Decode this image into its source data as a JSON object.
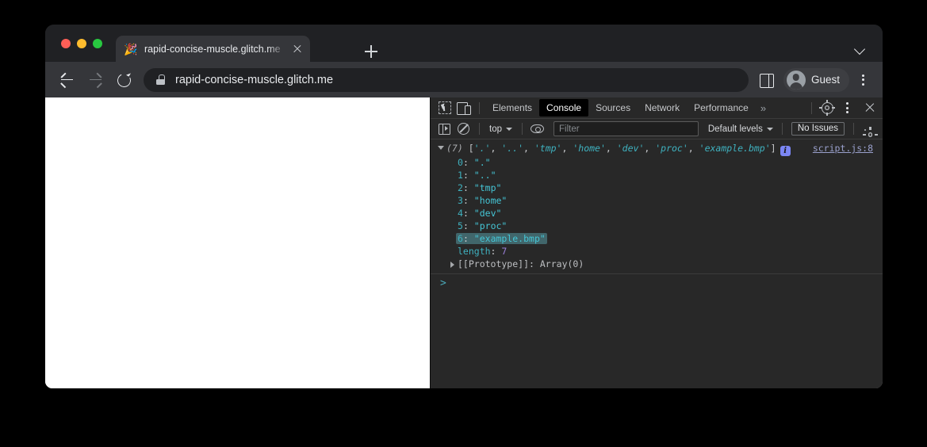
{
  "window": {
    "traffic_lights": [
      "close",
      "minimize",
      "maximize"
    ]
  },
  "tab": {
    "favicon": "party-popper-icon",
    "favicon_glyph": "🎉",
    "title": "rapid-concise-muscle.glitch.me",
    "close_label": "×"
  },
  "tabstrip": {
    "new_tab_label": "+",
    "tab_search_label": "⌄"
  },
  "toolbar": {
    "back_label": "Back",
    "forward_label": "Forward",
    "reload_label": "Reload",
    "url": "rapid-concise-muscle.glitch.me",
    "lock_label": "View site information",
    "side_panel_label": "Side panel",
    "profile_name": "Guest",
    "menu_label": "Customize and control Google Chrome"
  },
  "devtools": {
    "tabs": [
      {
        "label": "Elements",
        "active": false
      },
      {
        "label": "Console",
        "active": true
      },
      {
        "label": "Sources",
        "active": false
      },
      {
        "label": "Network",
        "active": false
      },
      {
        "label": "Performance",
        "active": false
      }
    ],
    "more_tabs_label": "»",
    "settings_label": "Settings",
    "menu_label": "More options",
    "close_label": "Close DevTools",
    "filterbar": {
      "sidebar_toggle_label": "Show console sidebar",
      "clear_label": "Clear console",
      "context": "top",
      "eye_label": "Create live expression",
      "filter_placeholder": "Filter",
      "filter_value": "",
      "levels": "Default levels",
      "issues": "No Issues",
      "settings_label": "Console settings"
    }
  },
  "console": {
    "entry": {
      "count_label": "(7)",
      "bracket_open": "[",
      "bracket_close": "]",
      "preview_items": [
        "'.'",
        "'..'",
        "'tmp'",
        "'home'",
        "'dev'",
        "'proc'",
        "'example.bmp'"
      ],
      "separator": ", ",
      "info_badge": "i",
      "source": "script.js:8",
      "properties": [
        {
          "index": "0",
          "value": "\".\"",
          "selected": false
        },
        {
          "index": "1",
          "value": "\"..\"",
          "selected": false
        },
        {
          "index": "2",
          "value": "\"tmp\"",
          "selected": false
        },
        {
          "index": "3",
          "value": "\"home\"",
          "selected": false
        },
        {
          "index": "4",
          "value": "\"dev\"",
          "selected": false
        },
        {
          "index": "5",
          "value": "\"proc\"",
          "selected": false
        },
        {
          "index": "6",
          "value": "\"example.bmp\"",
          "selected": true
        }
      ],
      "length_key": "length",
      "length_value": "7",
      "prototype_key": "[[Prototype]]",
      "prototype_value": "Array(0)"
    },
    "prompt": ">"
  },
  "colors": {
    "window_bg": "#202124",
    "toolbar_bg": "#35363a",
    "devtools_bg": "#282828",
    "page_bg": "#ffffff",
    "string_teal": "#45c6d6",
    "index_teal": "#3fb2c0",
    "number_purple": "#9a7fd8",
    "selection": "#41666b",
    "info_badge": "#7b86f4",
    "link": "#9aa0cc",
    "active_tab_bg": "#000000"
  }
}
